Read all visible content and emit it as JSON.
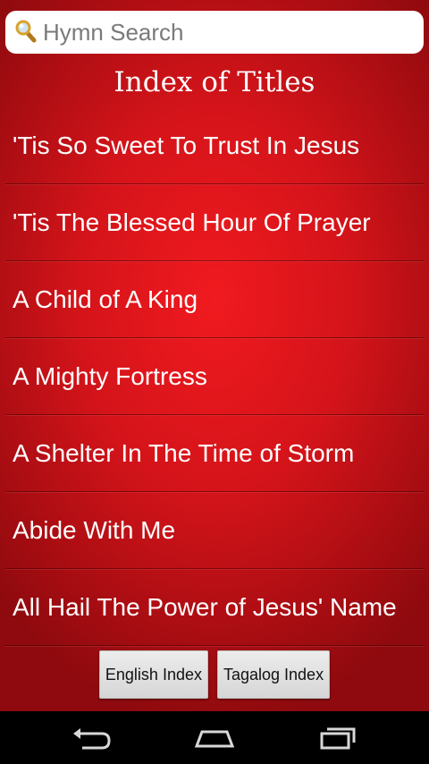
{
  "search": {
    "placeholder": "Hymn Search",
    "icon": "magnifier-icon"
  },
  "header": {
    "title": "Index of Titles"
  },
  "hymns": [
    {
      "title": "'Tis So Sweet To Trust In Jesus"
    },
    {
      "title": "'Tis The Blessed Hour Of Prayer"
    },
    {
      "title": "A Child of A King"
    },
    {
      "title": "A Mighty Fortress"
    },
    {
      "title": "A Shelter In The Time of Storm"
    },
    {
      "title": "Abide With Me"
    },
    {
      "title": "All Hail The Power of Jesus' Name"
    }
  ],
  "buttons": {
    "english_index": "English Index",
    "tagalog_index": "Tagalog Index"
  },
  "navigation": {
    "back": "back-icon",
    "home": "home-icon",
    "recents": "recent-apps-icon"
  },
  "colors": {
    "background": "#d4141a",
    "text": "#ffffff",
    "search_text": "#7a7a7a"
  }
}
